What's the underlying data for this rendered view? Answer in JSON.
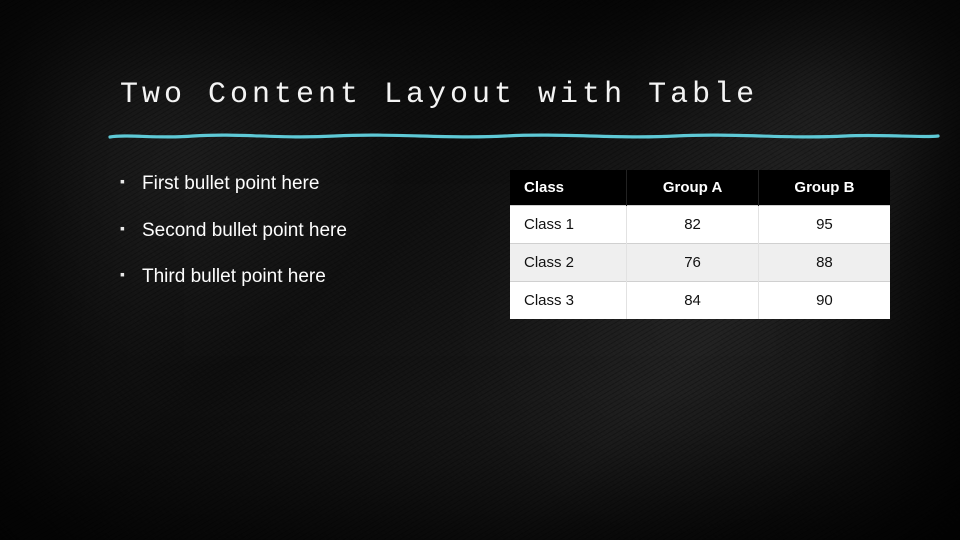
{
  "title": "Two Content Layout with Table",
  "bullets": [
    "First bullet point here",
    "Second bullet point here",
    "Third bullet point here"
  ],
  "table": {
    "headers": [
      "Class",
      "Group A",
      "Group B"
    ],
    "rows": [
      [
        "Class 1",
        "82",
        "95"
      ],
      [
        "Class 2",
        "76",
        "88"
      ],
      [
        "Class 3",
        "84",
        "90"
      ]
    ]
  },
  "colors": {
    "underline": "#5ec9d6"
  },
  "chart_data": {
    "type": "table",
    "title": "Two Content Layout with Table",
    "columns": [
      "Class",
      "Group A",
      "Group B"
    ],
    "rows": [
      {
        "Class": "Class 1",
        "Group A": 82,
        "Group B": 95
      },
      {
        "Class": "Class 2",
        "Group A": 76,
        "Group B": 88
      },
      {
        "Class": "Class 3",
        "Group A": 84,
        "Group B": 90
      }
    ]
  }
}
